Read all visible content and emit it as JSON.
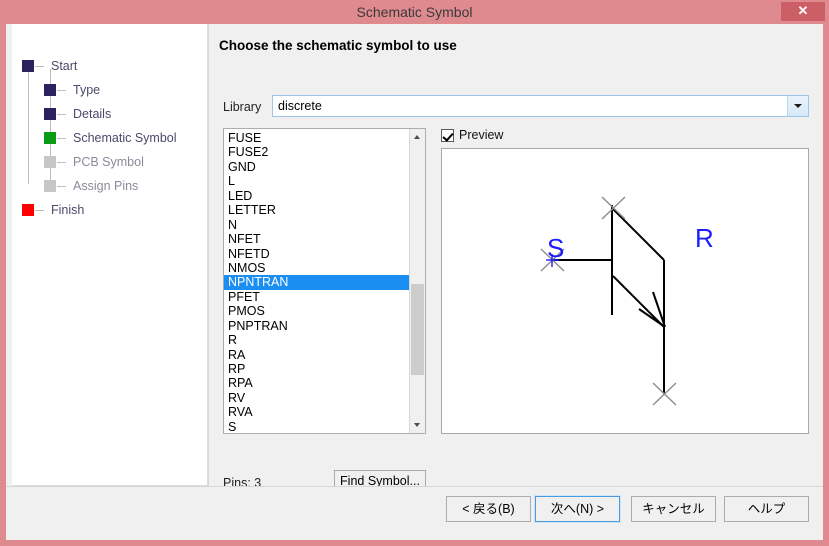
{
  "window": {
    "title": "Schematic Symbol",
    "close_label": "✕",
    "frame_color": "#df8a8f",
    "close_color": "#cc5f66"
  },
  "sidebar": {
    "items": [
      {
        "label": "Start",
        "state": "done",
        "color": "#2e2160",
        "indent": 0
      },
      {
        "label": "Type",
        "state": "done",
        "color": "#2e2160",
        "indent": 1
      },
      {
        "label": "Details",
        "state": "done",
        "color": "#2e2160",
        "indent": 1
      },
      {
        "label": "Schematic Symbol",
        "state": "current",
        "color": "#0a9a16",
        "indent": 1
      },
      {
        "label": "PCB Symbol",
        "state": "pending",
        "color": "#c6c6c6",
        "indent": 1
      },
      {
        "label": "Assign Pins",
        "state": "pending",
        "color": "#c6c6c6",
        "indent": 1
      },
      {
        "label": "Finish",
        "state": "end",
        "color": "#ff0000",
        "indent": 0
      }
    ]
  },
  "pane": {
    "heading": "Choose the schematic symbol to use",
    "library_label": "Library",
    "library_value": "discrete",
    "library_icon": "chevron-down-icon",
    "symbols": [
      "FUSE",
      "FUSE2",
      "GND",
      "L",
      "LED",
      "LETTER",
      "N",
      "NFET",
      "NFETD",
      "NMOS",
      "NPNTRAN",
      "PFET",
      "PMOS",
      "PNPTRAN",
      "R",
      "RA",
      "RP",
      "RPA",
      "RV",
      "RVA",
      "S"
    ],
    "selected_symbol": "NPNTRAN",
    "pins_text": "Pins: 3",
    "find_symbol_label": "Find Symbol...",
    "preview_label": "Preview",
    "preview_checked": true,
    "preview": {
      "symbol": "NPNTRAN",
      "pin_labels": [
        {
          "name": "S",
          "color": "#1c1cff"
        },
        {
          "name": "R",
          "color": "#1c1cff"
        }
      ],
      "line_color": "#000000",
      "mark_color": "#7a7a7a"
    }
  },
  "footer": {
    "back_label": "< 戻る(B)",
    "next_label": "次へ(N) >",
    "cancel_label": "キャンセル",
    "help_label": "ヘルプ",
    "default_button": "next"
  }
}
